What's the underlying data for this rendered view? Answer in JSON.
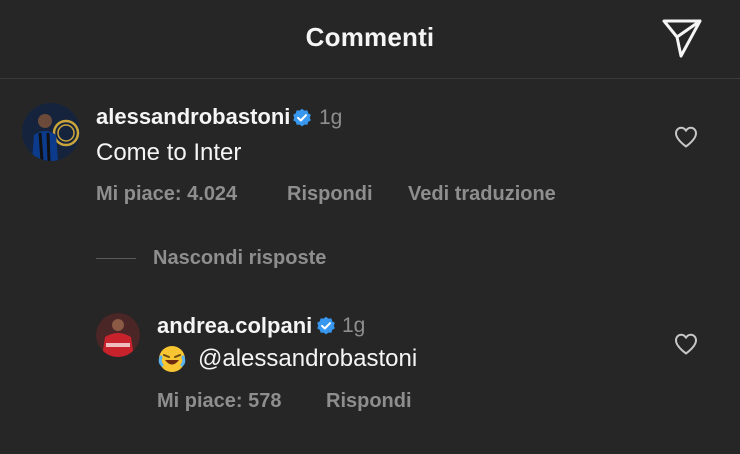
{
  "header": {
    "title": "Commenti",
    "send_icon": "paper-plane-icon"
  },
  "colors": {
    "background": "#262626",
    "text_primary": "#f5f5f5",
    "text_secondary": "#8e8e8e",
    "verified_badge": "#3897f0"
  },
  "comment": {
    "username": "alessandrobastoni",
    "verified": true,
    "time": "1g",
    "text": "Come to Inter",
    "likes_label": "Mi piace: 4.024",
    "reply_label": "Rispondi",
    "translate_label": "Vedi traduzione",
    "heart_icon": "heart-outline-icon"
  },
  "replies_toggle": "Nascondi risposte",
  "reply": {
    "username": "andrea.colpani",
    "verified": true,
    "time": "1g",
    "emoji": "😂",
    "mention": "@alessandrobastoni",
    "likes_label": "Mi piace: 578",
    "reply_label": "Rispondi",
    "heart_icon": "heart-outline-icon"
  }
}
